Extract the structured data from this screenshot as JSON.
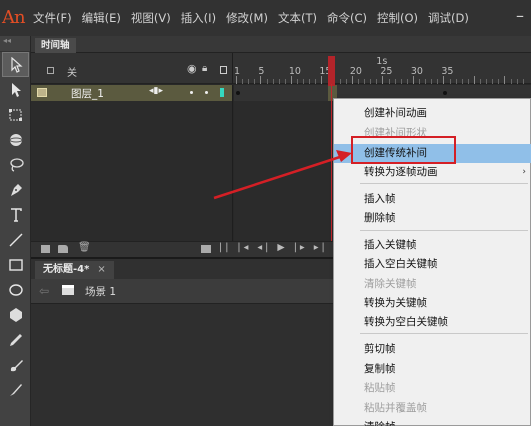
{
  "app": {
    "logo": "An"
  },
  "menubar": {
    "items": [
      "文件(F)",
      "编辑(E)",
      "视图(V)",
      "插入(I)",
      "修改(M)",
      "文本(T)",
      "命令(C)",
      "控制(O)",
      "调试(D)"
    ],
    "minimize_glyph": "–"
  },
  "timeline": {
    "tab_label": "时间轴",
    "header": {
      "layer_toggle": "关",
      "seconds_label": "1s"
    },
    "ruler": [
      "1",
      "5",
      "10",
      "15",
      "20",
      "25",
      "30",
      "35"
    ],
    "layer_name": "图层_1"
  },
  "document": {
    "tab_label": "无标题-4*",
    "close_glyph": "×",
    "scene_label": "场景 1"
  },
  "context_menu": {
    "items": [
      {
        "label": "创建补间动画",
        "disabled": false
      },
      {
        "label": "创建补间形状",
        "disabled": true
      },
      {
        "label": "创建传统补间",
        "disabled": false,
        "highlighted": true
      },
      {
        "label": "转换为逐帧动画",
        "disabled": false,
        "submenu": true
      },
      {
        "label": "插入帧",
        "disabled": false
      },
      {
        "label": "删除帧",
        "disabled": false
      },
      {
        "label": "插入关键帧",
        "disabled": false
      },
      {
        "label": "插入空白关键帧",
        "disabled": false
      },
      {
        "label": "清除关键帧",
        "disabled": true
      },
      {
        "label": "转换为关键帧",
        "disabled": false
      },
      {
        "label": "转换为空白关键帧",
        "disabled": false
      },
      {
        "label": "剪切帧",
        "disabled": false
      },
      {
        "label": "复制帧",
        "disabled": false
      },
      {
        "label": "粘贴帧",
        "disabled": true
      },
      {
        "label": "粘贴并覆盖帧",
        "disabled": true
      },
      {
        "label": "清除帧",
        "disabled": false
      }
    ],
    "submenu_glyph": "›"
  },
  "colors": {
    "annotation": "#d41f25",
    "highlight": "#90bfe8",
    "playhead": "#c1272d",
    "layer_row": "#5b5a3f",
    "logo": "#e34e25"
  }
}
